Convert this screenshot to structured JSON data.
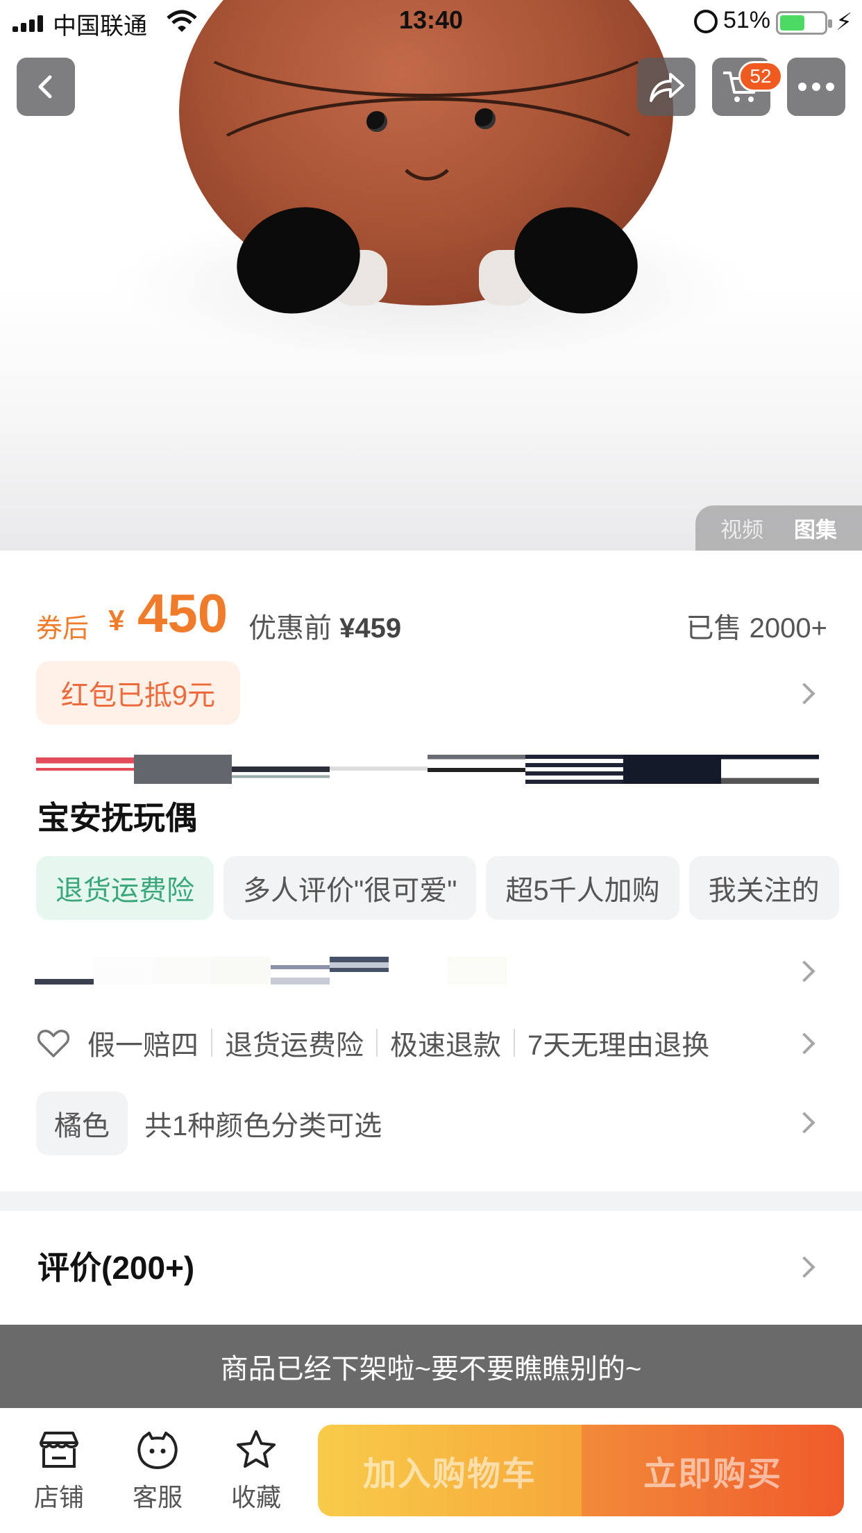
{
  "status_bar": {
    "carrier": "中国联通",
    "time": "13:40",
    "battery_pct": "51%"
  },
  "nav": {
    "cart_badge": "52"
  },
  "media_tabs": {
    "video": "视频",
    "gallery": "图集"
  },
  "price": {
    "after_coupon_label": "券后",
    "currency": "¥",
    "value": "450",
    "original_label": "优惠前",
    "original_value": "¥459",
    "sold": "已售 2000+"
  },
  "coupon": {
    "label": "红包已抵9元"
  },
  "product": {
    "title": "宝安抚玩偶"
  },
  "tags": [
    "退货运费险",
    "多人评价\"很可爱\"",
    "超5千人加购",
    "我关注的"
  ],
  "guarantees": [
    "假一赔四",
    "退货运费险",
    "极速退款",
    "7天无理由退换"
  ],
  "color": {
    "chip": "橘色",
    "description": "共1种颜色分类可选"
  },
  "reviews": {
    "label": "评价(200+)"
  },
  "notice": {
    "off_shelf": "商品已经下架啦~要不要瞧瞧别的~"
  },
  "bottom_bar": {
    "store": "店铺",
    "service": "客服",
    "favorite": "收藏",
    "add_to_cart": "加入购物车",
    "buy_now": "立即购买"
  },
  "colors": {
    "accent": "#f07b2b",
    "buy_gradient_start": "#f28a3a",
    "buy_gradient_end": "#ef5a2b",
    "cart_gradient_start": "#f8cb4a",
    "cart_gradient_end": "#f6a73a",
    "tag_green": "#3aa77a",
    "coupon_bg": "#fff0e8"
  },
  "icons": {
    "back": "chevron-left-icon",
    "share": "share-arrow-icon",
    "cart": "shopping-cart-icon",
    "more": "more-dots-icon",
    "heart": "heart-outline-icon",
    "store": "store-icon",
    "service": "service-face-icon",
    "favorite": "star-outline-icon"
  }
}
